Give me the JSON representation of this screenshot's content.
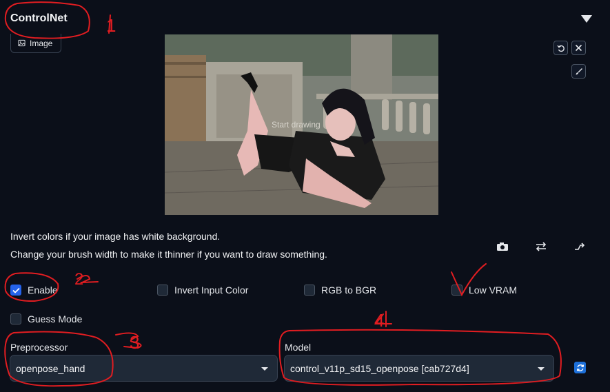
{
  "panel": {
    "title": "ControlNet",
    "image_tab_label": "Image",
    "canvas_overlay_text": "Start drawing"
  },
  "help": {
    "line1": "Invert colors if your image has white background.",
    "line2": "Change your brush width to make it thinner if you want to draw something."
  },
  "checkboxes": {
    "enable": {
      "label": "Enable",
      "checked": true
    },
    "invert_input_color": {
      "label": "Invert Input Color",
      "checked": false
    },
    "rgb_to_bgr": {
      "label": "RGB to BGR",
      "checked": false
    },
    "low_vram": {
      "label": "Low VRAM",
      "checked": false
    },
    "guess_mode": {
      "label": "Guess Mode",
      "checked": false
    }
  },
  "preprocessor": {
    "label": "Preprocessor",
    "value": "openpose_hand"
  },
  "model": {
    "label": "Model",
    "value": "control_v11p_sd15_openpose [cab727d4]"
  },
  "annotations": {
    "n1": "1",
    "n2": "2",
    "n3": "3",
    "n4": "4"
  },
  "colors": {
    "accent": "#2563eb",
    "annotation": "#e11d21",
    "background": "#0b0f19"
  }
}
